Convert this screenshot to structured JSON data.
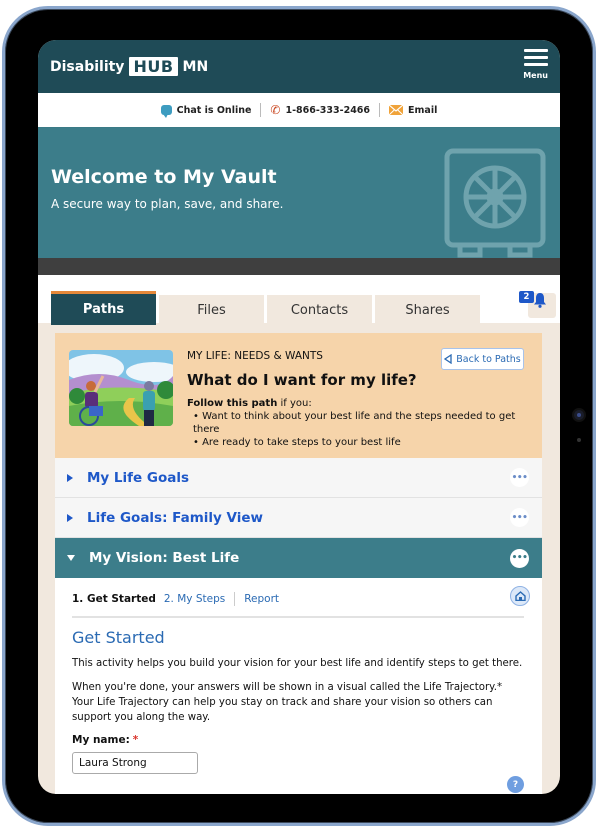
{
  "header": {
    "logo_left": "Disability",
    "logo_hub": "HUB",
    "logo_right": "MN",
    "menu_label": "Menu",
    "menu_icon": "hamburger-icon"
  },
  "contact": {
    "chat": "Chat is Online",
    "phone": "1-866-333-2466",
    "email": "Email",
    "icons": [
      "chat-bubble-icon",
      "phone-icon",
      "envelope-icon"
    ]
  },
  "hero": {
    "title": "Welcome to My Vault",
    "subtitle": "A secure way to plan, save, and share.",
    "icon": "vault-safe-icon"
  },
  "tabs": [
    {
      "label": "Paths",
      "active": true
    },
    {
      "label": "Files",
      "active": false
    },
    {
      "label": "Contacts",
      "active": false
    },
    {
      "label": "Shares",
      "active": false
    }
  ],
  "notifications": {
    "count": "2",
    "icon": "bell-icon"
  },
  "path_card": {
    "eyebrow": "MY LIFE: NEEDS & WANTS",
    "title": "What do I want for my life?",
    "follow_bold": "Follow this path",
    "follow_rest": " if you:",
    "bullets": [
      "• Want to think about your best life and the steps needed to get there",
      "• Are ready to take steps to your best life"
    ],
    "back_button": "Back to Paths",
    "image": "illustration-wheelchair-user-and-friend-outdoors"
  },
  "accordion": [
    {
      "title": "My Life Goals",
      "open": false
    },
    {
      "title": "Life Goals: Family View",
      "open": false
    },
    {
      "title": "My Vision: Best Life",
      "open": true
    }
  ],
  "panel": {
    "steps": {
      "current": "1. Get Started",
      "next": "2. My Steps",
      "report": "Report"
    },
    "heading": "Get Started",
    "para1": "This activity helps you build your vision for your best life and identify steps to get there.",
    "para2": "When you're done, your answers will be shown in a visual called the Life Trajectory.* Your Life Trajectory can help you stay on track and share your vision so others can support you along the way.",
    "name_label": "My name:",
    "required_mark": "*",
    "name_value": "Laura Strong",
    "help": "?"
  },
  "colors": {
    "brand_dark": "#1f4b57",
    "teal": "#3c7d8a",
    "accent_orange": "#e5883a",
    "link_blue": "#1e58c8",
    "card_peach": "#f6d4aa",
    "tab_beige": "#f1e8de"
  }
}
